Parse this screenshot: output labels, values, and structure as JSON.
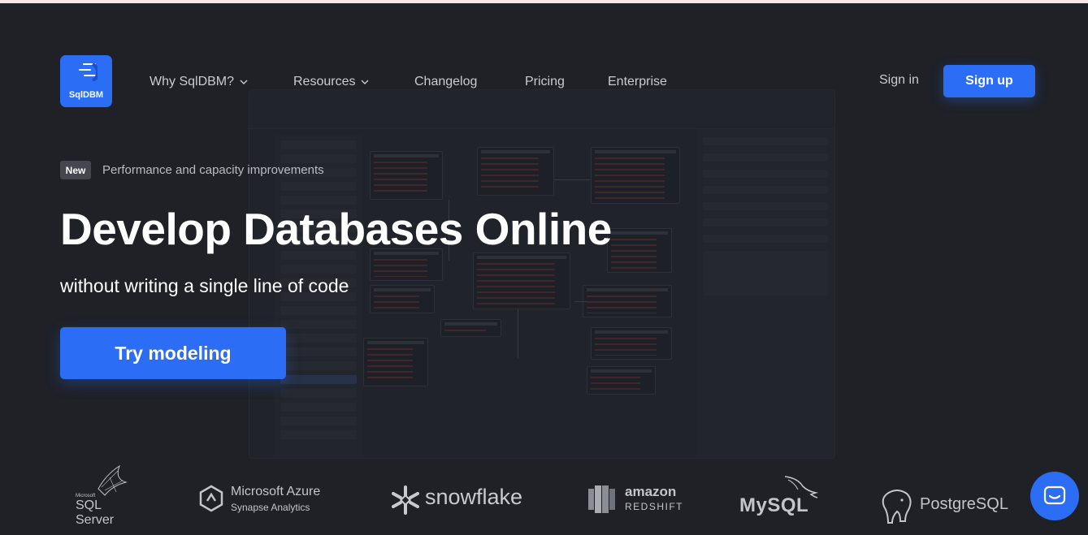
{
  "header": {
    "logo_text": "SqlDBM",
    "nav": [
      {
        "label": "Why SqlDBM?",
        "has_dropdown": true
      },
      {
        "label": "Resources",
        "has_dropdown": true
      },
      {
        "label": "Changelog",
        "has_dropdown": false
      },
      {
        "label": "Pricing",
        "has_dropdown": false
      },
      {
        "label": "Enterprise",
        "has_dropdown": false
      }
    ],
    "sign_in": "Sign in",
    "sign_up": "Sign up"
  },
  "hero": {
    "badge": "New",
    "announcement": "Performance and capacity improvements",
    "headline": "Develop Databases Online",
    "subheadline": "without writing a single line of code",
    "cta": "Try modeling"
  },
  "partners": {
    "sqlserver": {
      "small": "Microsoft",
      "name": "SQL Server",
      "icon": "sql-server-icon"
    },
    "azure": {
      "name": "Microsoft Azure",
      "sub": "Synapse Analytics",
      "icon": "azure-synapse-icon"
    },
    "snowflake": {
      "name": "snowflake",
      "icon": "snowflake-icon"
    },
    "redshift": {
      "name": "amazon",
      "sub": "REDSHIFT",
      "icon": "redshift-icon"
    },
    "mysql": {
      "name": "MySQL",
      "icon": "dolphin-icon"
    },
    "postgresql": {
      "name": "PostgreSQL",
      "icon": "elephant-icon"
    }
  },
  "colors": {
    "background": "#1f2127",
    "accent": "#2b6ef5",
    "text": "#ffffff",
    "muted": "#c9cbd0"
  }
}
